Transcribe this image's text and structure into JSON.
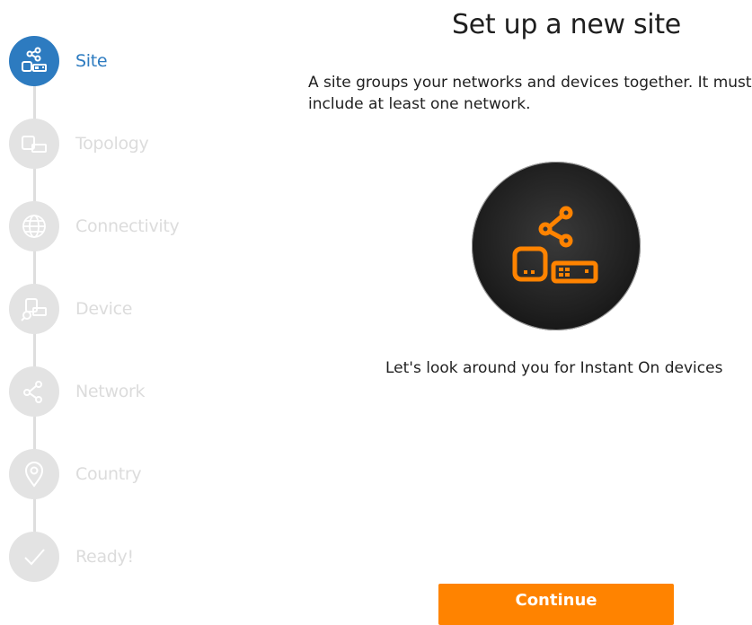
{
  "title": "Set up a new site",
  "description": "A site groups your networks and devices together. It must include at least one network.",
  "scan_text": "Let's look around you for Instant On devices",
  "continue_label": "Continue",
  "steps": [
    {
      "label": "Site",
      "icon": "site-icon",
      "active": true
    },
    {
      "label": "Topology",
      "icon": "topology-icon",
      "active": false
    },
    {
      "label": "Connectivity",
      "icon": "globe-icon",
      "active": false
    },
    {
      "label": "Device",
      "icon": "device-search-icon",
      "active": false
    },
    {
      "label": "Network",
      "icon": "network-icon",
      "active": false
    },
    {
      "label": "Country",
      "icon": "location-pin-icon",
      "active": false
    },
    {
      "label": "Ready!",
      "icon": "checkmark-icon",
      "active": false
    }
  ],
  "colors": {
    "active_step": "#2d7bc0",
    "inactive_step": "#e3e3e3",
    "accent": "#ff8300",
    "illustration_bg": "#1f1f1f"
  }
}
